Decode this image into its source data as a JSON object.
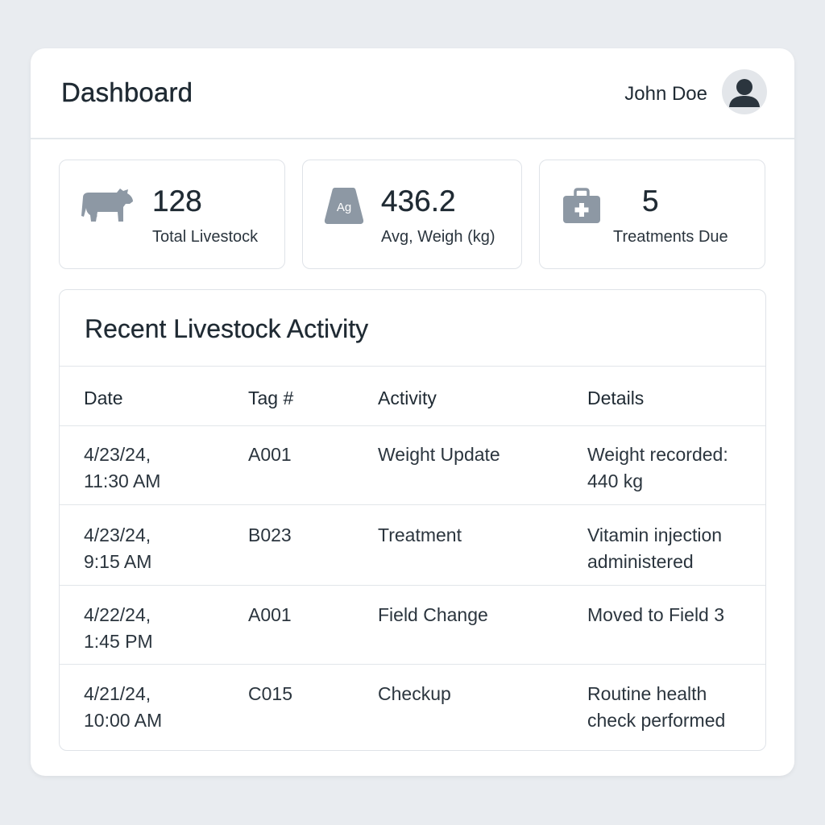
{
  "header": {
    "title": "Dashboard",
    "user_name": "John Doe",
    "avatar_icon": "user-silhouette-icon"
  },
  "stats": [
    {
      "icon": "cow-icon",
      "value": "128",
      "label": "Total Livestock"
    },
    {
      "icon": "weight-icon",
      "icon_text": "Ag",
      "value": "436.2",
      "label": "Avg, Weigh (kg)"
    },
    {
      "icon": "medical-kit-icon",
      "value": "5",
      "label": "Treatments Due"
    }
  ],
  "activity": {
    "title": "Recent Livestock Activity",
    "columns": [
      "Date",
      "Tag #",
      "Activity",
      "Details"
    ],
    "rows": [
      {
        "date_line1": "4/23/24,",
        "date_line2": "11:30 AM",
        "tag": "A001",
        "activity": "Weight Update",
        "details_line1": "Weight recorded:",
        "details_line2": "440 kg"
      },
      {
        "date_line1": "4/23/24,",
        "date_line2": "9:15 AM",
        "tag": "B023",
        "activity": "Treatment",
        "details_line1": "Vitamin injection",
        "details_line2": "administered"
      },
      {
        "date_line1": "4/22/24,",
        "date_line2": "1:45 PM",
        "tag": "A001",
        "activity": "Field Change",
        "details_line1": "Moved to Field 3",
        "details_line2": ""
      },
      {
        "date_line1": "4/21/24,",
        "date_line2": "10:00 AM",
        "tag": "C015",
        "activity": "Checkup",
        "details_line1": "Routine health",
        "details_line2": "check performed"
      }
    ]
  },
  "colors": {
    "background": "#e9ecf0",
    "card": "#ffffff",
    "border": "#dfe3e8",
    "text": "#1f2a33",
    "icon": "#8d98a4",
    "avatar_fg": "#2b353e"
  }
}
